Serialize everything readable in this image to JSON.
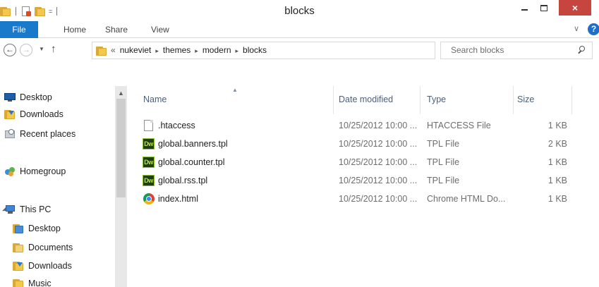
{
  "window": {
    "title": "blocks",
    "close_glyph": "×",
    "qat_glyph": "="
  },
  "ribbon": {
    "tabs": [
      {
        "label": "File"
      },
      {
        "label": "Home"
      },
      {
        "label": "Share"
      },
      {
        "label": "View"
      }
    ],
    "expand_glyph": "∨",
    "help_glyph": "?"
  },
  "address_bar": {
    "overflow_glyph": "«",
    "breadcrumbs": [
      "nukeviet",
      "themes",
      "modern",
      "blocks"
    ],
    "separator_glyph": "▸"
  },
  "search": {
    "placeholder": "Search blocks"
  },
  "nav": {
    "back_glyph": "←",
    "forward_glyph": "→",
    "recent_glyph": "▼",
    "up_glyph": "↑",
    "dropdown_glyph": "∨",
    "refresh_glyph": "↻"
  },
  "navigation_pane": {
    "favorites": [
      {
        "label": "Desktop",
        "icon": "desktop-icon"
      },
      {
        "label": "Downloads",
        "icon": "downloads-folder-icon"
      },
      {
        "label": "Recent places",
        "icon": "recent-places-icon"
      }
    ],
    "homegroup": {
      "label": "Homegroup",
      "icon": "homegroup-icon"
    },
    "this_pc": {
      "label": "This PC",
      "icon": "computer-icon"
    },
    "this_pc_children": [
      {
        "label": "Desktop",
        "icon": "desktop-folder-icon"
      },
      {
        "label": "Documents",
        "icon": "documents-folder-icon"
      },
      {
        "label": "Downloads",
        "icon": "downloads-folder-icon"
      },
      {
        "label": "Music",
        "icon": "music-folder-icon"
      }
    ],
    "caret_glyph": "◢",
    "scroll_up_glyph": "▲"
  },
  "file_list": {
    "columns": {
      "name": "Name",
      "date_modified": "Date modified",
      "type": "Type",
      "size": "Size"
    },
    "sort_glyph": "▲",
    "rows": [
      {
        "name": ".htaccess",
        "date": "10/25/2012 10:00 ...",
        "type": "HTACCESS File",
        "size": "1 KB",
        "icon": "generic-file-icon"
      },
      {
        "name": "global.banners.tpl",
        "date": "10/25/2012 10:00 ...",
        "type": "TPL File",
        "size": "2 KB",
        "icon": "dreamweaver-file-icon"
      },
      {
        "name": "global.counter.tpl",
        "date": "10/25/2012 10:00 ...",
        "type": "TPL File",
        "size": "1 KB",
        "icon": "dreamweaver-file-icon"
      },
      {
        "name": "global.rss.tpl",
        "date": "10/25/2012 10:00 ...",
        "type": "TPL File",
        "size": "1 KB",
        "icon": "dreamweaver-file-icon"
      },
      {
        "name": "index.html",
        "date": "10/25/2012 10:00 ...",
        "type": "Chrome HTML Do...",
        "size": "1 KB",
        "icon": "chrome-file-icon"
      }
    ],
    "dw_badge": "Dw"
  },
  "colors": {
    "accent": "#1979ca",
    "close_button": "#c7453f",
    "column_header_text": "#4c607a",
    "folder": "#f2c94c"
  }
}
